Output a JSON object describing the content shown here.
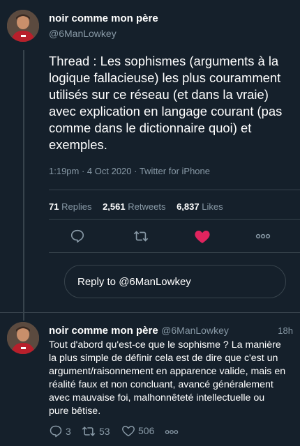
{
  "tweet_main": {
    "author_name": "noir comme mon père",
    "author_handle": "@6ManLowkey",
    "text": "Thread : Les sophismes (arguments à la logique fallacieuse) les plus couramment utilisés sur ce réseau (et dans la vraie) avec explication en langage courant (pas comme dans le dictionnaire quoi) et exemples.",
    "meta": "1:19pm · 4 Oct 2020 · Twitter for iPhone",
    "stats": {
      "replies_count": "71",
      "replies_label": "Replies",
      "retweets_count": "2,561",
      "retweets_label": "Retweets",
      "likes_count": "6,837",
      "likes_label": "Likes"
    }
  },
  "reply_box": {
    "label": "Reply to @6ManLowkey"
  },
  "tweet_reply": {
    "author_name": "noir comme mon père",
    "author_handle": "@6ManLowkey",
    "time": "18h",
    "text": "Tout d'abord qu'est-ce que le sophisme ? La manière la plus simple de définir cela est de dire que c'est un argument/raisonnement en apparence valide, mais en réalité faux et non concluant, avancé généralement avec mauvaise foi, malhonnêteté intellectuelle ou pure bêtise.",
    "replies": "3",
    "retweets": "53",
    "likes": "506"
  },
  "icons": {
    "reply": "reply-icon",
    "retweet": "retweet-icon",
    "like": "heart-icon",
    "more": "more-icon"
  },
  "colors": {
    "background": "#15202b",
    "secondary_text": "#8899a6",
    "border": "#38444d",
    "like_active": "#e0245e"
  }
}
